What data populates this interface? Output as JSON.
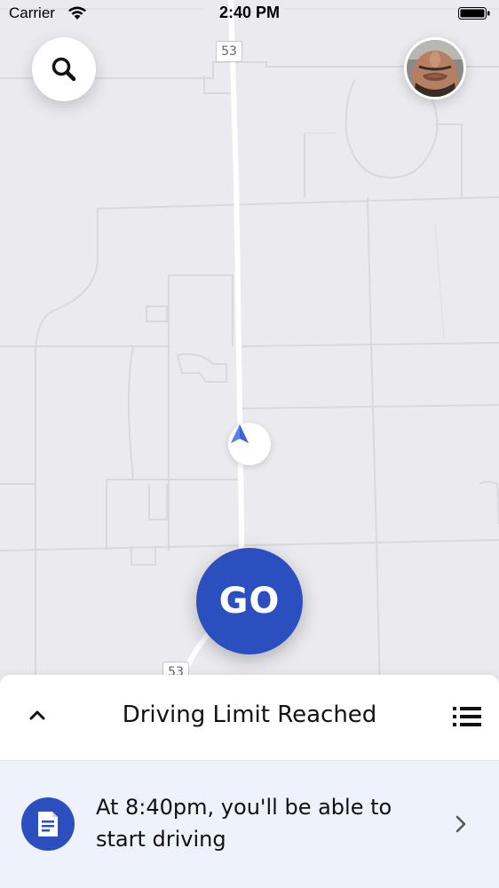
{
  "status_bar": {
    "carrier": "Carrier",
    "time": "2:40 PM"
  },
  "map": {
    "route_shield_top": "53",
    "route_shield_bottom": "53"
  },
  "go_button": {
    "label": "GO"
  },
  "bottom_sheet": {
    "title": "Driving Limit Reached",
    "info_message": "At 8:40pm, you'll be able to start driving"
  },
  "colors": {
    "accent": "#2c4fbf",
    "map_background": "#ebebef",
    "card_background": "#eef2fa"
  },
  "icons": {
    "search": "search-icon",
    "profile": "avatar",
    "navigation": "navigation-arrow-icon",
    "collapse": "chevron-up-icon",
    "menu": "list-icon",
    "document": "document-icon",
    "disclosure": "chevron-right-icon"
  }
}
